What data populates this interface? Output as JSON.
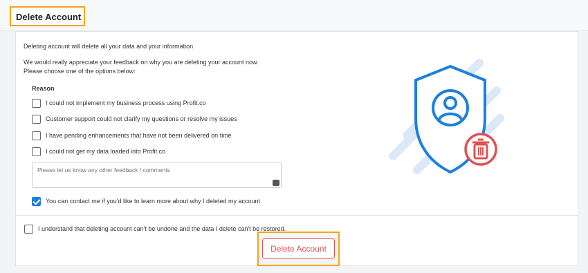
{
  "header": {
    "title": "Delete Account"
  },
  "intro": {
    "line1": "Deleting account will delete all your data and your information",
    "line2": "We would really appreciate your feedback on why you are deleting your account now.",
    "line3": "Please choose one of the options below:"
  },
  "reason": {
    "heading": "Reason",
    "options": [
      {
        "label": "I could not implement my business process using Profit.co",
        "checked": false
      },
      {
        "label": "Customer support could not clarify my questions or resolve my issues",
        "checked": false
      },
      {
        "label": "I have pending enhancements that have not been delivered on time",
        "checked": false
      },
      {
        "label": "I could not get my data loaded into Profit.co",
        "checked": false
      }
    ]
  },
  "feedback": {
    "placeholder": "Please let us know any other feedback / comments"
  },
  "contact": {
    "label": "You can contact me if you'd like to learn more about why I deleted my account",
    "checked": true
  },
  "confirm": {
    "label": "I understand that deleting account can't be undone and the data I delete can't be restored.",
    "checked": false
  },
  "actions": {
    "delete_label": "Delete Account"
  },
  "colors": {
    "accent": "#1c7fe0",
    "danger": "#e05252",
    "highlight": "#f5a31a"
  },
  "illustration": {
    "icons": [
      "shield-icon",
      "user-icon",
      "trash-icon"
    ]
  }
}
